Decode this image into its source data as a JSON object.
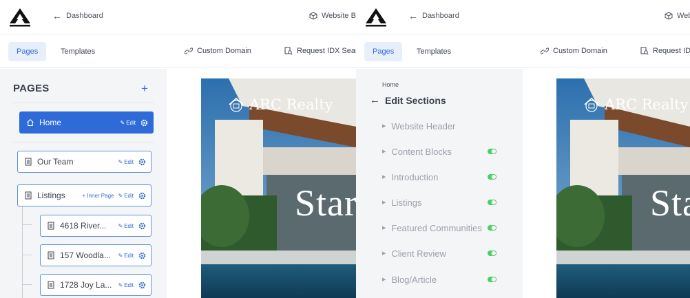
{
  "header": {
    "back_label": "Dashboard",
    "site_builder_label": "Website Bui",
    "site_builder_label_right": "Web"
  },
  "tabs": [
    {
      "label": "Pages",
      "active": true
    },
    {
      "label": "Templates",
      "active": false
    }
  ],
  "toolbar": {
    "custom_domain": "Custom Domain",
    "request_idx_left": "Request IDX Search",
    "request_idx_right": "Request IDX"
  },
  "sidebar": {
    "title": "PAGES",
    "add_label": "+",
    "edit_label": "Edit",
    "inner_page_label": "+ Inner Page",
    "pages": [
      {
        "label": "Home"
      },
      {
        "label": "Our Team"
      },
      {
        "label": "Listings"
      },
      {
        "label": "4618 River..."
      },
      {
        "label": "157 Woodla..."
      },
      {
        "label": "1728 Joy La..."
      }
    ]
  },
  "preview": {
    "brand": "ARC Realty",
    "hero_left": "Star",
    "hero_right": "Sta"
  },
  "sections_panel": {
    "breadcrumb": "Home",
    "title": "Edit Sections",
    "sections": [
      {
        "label": "Website Header",
        "enabled": false
      },
      {
        "label": "Content Blocks",
        "enabled": true
      },
      {
        "label": "Introduction",
        "enabled": true
      },
      {
        "label": "Listings",
        "enabled": true
      },
      {
        "label": "Featured Communities",
        "enabled": true
      },
      {
        "label": "Client Review",
        "enabled": true
      },
      {
        "label": "Blog/Article",
        "enabled": true
      }
    ]
  },
  "colors": {
    "accent": "#2e6bd8",
    "active_tab_bg": "#e7effb",
    "sidebar_bg": "#f4f5f7",
    "toggle_on": "#4ccf68"
  },
  "icons": {
    "logo": "access-logo-icon",
    "back": "arrow-left-icon",
    "builder": "cube-icon",
    "domain": "link-icon",
    "idx": "search-document-icon",
    "page": "document-icon",
    "home": "home-icon",
    "edit": "pencil-icon",
    "settings": "gear-icon"
  }
}
